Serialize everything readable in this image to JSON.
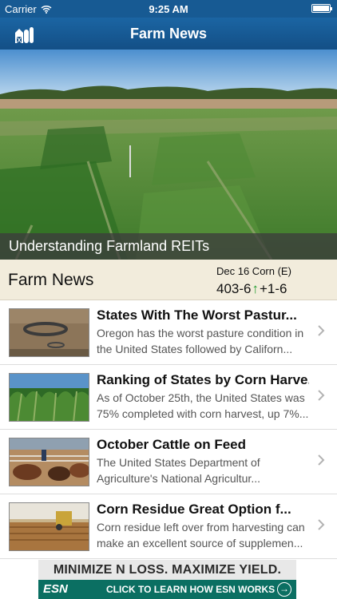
{
  "status_bar": {
    "carrier": "Carrier",
    "time": "9:25 AM"
  },
  "nav": {
    "title": "Farm News",
    "icon": "barn-icon"
  },
  "hero": {
    "caption": "Understanding Farmland REITs"
  },
  "header": {
    "label": "Farm News",
    "quote_name": "Dec 16 Corn (E)",
    "quote_price": "403-6",
    "quote_change": "+1-6",
    "change_color": "#1e9c2e"
  },
  "articles": [
    {
      "title": "States With The Worst Pastur...",
      "desc1": "Oregon has the worst pasture condition in",
      "desc2": "the United States followed by Californ..."
    },
    {
      "title": "Ranking of States by Corn Harve...",
      "desc1": "As of October 25th, the United States was",
      "desc2": "75% completed with corn harvest, up 7%..."
    },
    {
      "title": "October Cattle on Feed",
      "desc1": "The United States Department of",
      "desc2": "Agriculture's National Agricultur..."
    },
    {
      "title": "Corn Residue Great Option f...",
      "desc1": "Corn residue left over from harvesting can",
      "desc2": "make an excellent source of supplemen..."
    }
  ],
  "ad": {
    "headline": "MINIMIZE N LOSS. MAXIMIZE YIELD.",
    "brand": "ESN",
    "cta": "CLICK TO LEARN HOW ESN WORKS"
  }
}
